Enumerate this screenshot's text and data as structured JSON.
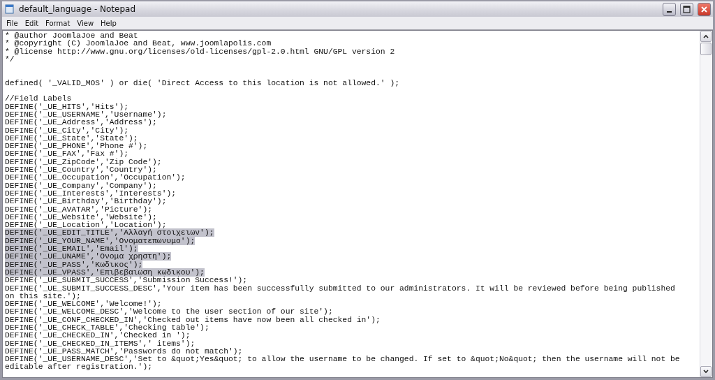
{
  "window": {
    "title": "default_language - Notepad"
  },
  "menu": [
    {
      "label": "File"
    },
    {
      "label": "Edit"
    },
    {
      "label": "Format"
    },
    {
      "label": "View"
    },
    {
      "label": "Help"
    }
  ],
  "lines": [
    {
      "kind": "text",
      "text": "* @author JoomlaJoe and Beat",
      "selected": false
    },
    {
      "kind": "text",
      "text": "* @copyright (C) JoomlaJoe and Beat, www.joomlapolis.com",
      "selected": false
    },
    {
      "kind": "text",
      "text": "* @license http://www.gnu.org/licenses/old-licenses/gpl-2.0.html GNU/GPL version 2",
      "selected": false
    },
    {
      "kind": "text",
      "text": "*/",
      "selected": false
    },
    {
      "kind": "blank"
    },
    {
      "kind": "blank"
    },
    {
      "kind": "text",
      "text": "defined( '_VALID_MOS' ) or die( 'Direct Access to this location is not allowed.' );",
      "selected": false
    },
    {
      "kind": "blank"
    },
    {
      "kind": "text",
      "text": "//Field Labels",
      "selected": false
    },
    {
      "kind": "text",
      "text": "DEFINE('_UE_HITS','Hits');",
      "selected": false
    },
    {
      "kind": "text",
      "text": "DEFINE('_UE_USERNAME','Username');",
      "selected": false
    },
    {
      "kind": "text",
      "text": "DEFINE('_UE_Address','Address');",
      "selected": false
    },
    {
      "kind": "text",
      "text": "DEFINE('_UE_City','City');",
      "selected": false
    },
    {
      "kind": "text",
      "text": "DEFINE('_UE_State','State');",
      "selected": false
    },
    {
      "kind": "text",
      "text": "DEFINE('_UE_PHONE','Phone #');",
      "selected": false
    },
    {
      "kind": "text",
      "text": "DEFINE('_UE_FAX','Fax #');",
      "selected": false
    },
    {
      "kind": "text",
      "text": "DEFINE('_UE_ZipCode','Zip Code');",
      "selected": false
    },
    {
      "kind": "text",
      "text": "DEFINE('_UE_Country','Country');",
      "selected": false
    },
    {
      "kind": "text",
      "text": "DEFINE('_UE_Occupation','Occupation');",
      "selected": false
    },
    {
      "kind": "text",
      "text": "DEFINE('_UE_Company','Company');",
      "selected": false
    },
    {
      "kind": "text",
      "text": "DEFINE('_UE_Interests','Interests');",
      "selected": false
    },
    {
      "kind": "text",
      "text": "DEFINE('_UE_Birthday','Birthday');",
      "selected": false
    },
    {
      "kind": "text",
      "text": "DEFINE('_UE_AVATAR','Picture');",
      "selected": false
    },
    {
      "kind": "text",
      "text": "DEFINE('_UE_Website','Website');",
      "selected": false
    },
    {
      "kind": "text",
      "text": "DEFINE('_UE_Location','Location');",
      "selected": false
    },
    {
      "kind": "text",
      "text": "DEFINE('_UE_EDIT_TITLE','Αλλαγή στοιχειων');",
      "selected": true
    },
    {
      "kind": "text",
      "text": "DEFINE('_UE_YOUR_NAME','Ονοματεπωνυμο');",
      "selected": true
    },
    {
      "kind": "text",
      "text": "DEFINE('_UE_EMAIL','Email');",
      "selected": true
    },
    {
      "kind": "text",
      "text": "DEFINE('_UE_UNAME','Ονομα χρηστη');",
      "selected": true
    },
    {
      "kind": "text",
      "text": "DEFINE('_UE_PASS','Κωδικος');",
      "selected": true
    },
    {
      "kind": "text",
      "text": "DEFINE('_UE_VPASS','Επιβεβαιωση κωδικου');",
      "selected": true
    },
    {
      "kind": "text",
      "text": "DEFINE('_UE_SUBMIT_SUCCESS','Submission Success!');",
      "selected": false
    },
    {
      "kind": "text",
      "text": "DEFINE('_UE_SUBMIT_SUCCESS_DESC','Your item has been successfully submitted to our administrators. It will be reviewed before being published",
      "selected": false
    },
    {
      "kind": "text",
      "text": "on this site.');",
      "selected": false
    },
    {
      "kind": "text",
      "text": "DEFINE('_UE_WELCOME','Welcome!');",
      "selected": false
    },
    {
      "kind": "text",
      "text": "DEFINE('_UE_WELCOME_DESC','Welcome to the user section of our site');",
      "selected": false
    },
    {
      "kind": "text",
      "text": "DEFINE('_UE_CONF_CHECKED_IN','Checked out items have now been all checked in');",
      "selected": false
    },
    {
      "kind": "text",
      "text": "DEFINE('_UE_CHECK_TABLE','Checking table');",
      "selected": false
    },
    {
      "kind": "text",
      "text": "DEFINE('_UE_CHECKED_IN','Checked in ');",
      "selected": false
    },
    {
      "kind": "text",
      "text": "DEFINE('_UE_CHECKED_IN_ITEMS',' items');",
      "selected": false
    },
    {
      "kind": "text",
      "text": "DEFINE('_UE_PASS_MATCH','Passwords do not match');",
      "selected": false
    },
    {
      "kind": "text",
      "text": "DEFINE('_UE_USERNAME_DESC','Set to &quot;Yes&quot; to allow the username to be changed. If set to &quot;No&quot; then the username will not be",
      "selected": false
    },
    {
      "kind": "text",
      "text": "editable after registration.');",
      "selected": false
    }
  ]
}
